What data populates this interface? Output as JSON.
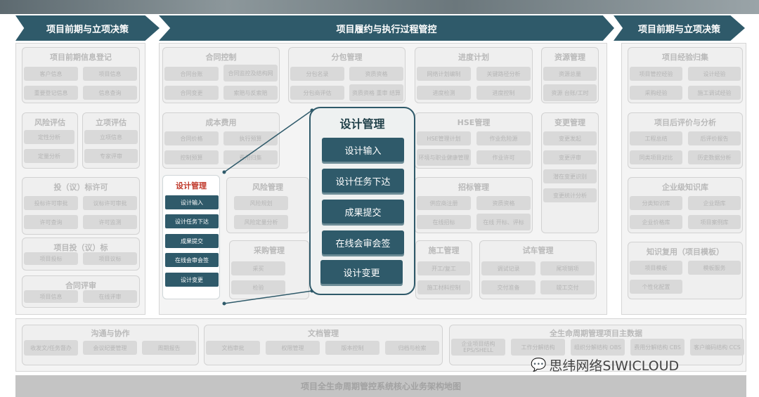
{
  "phases": [
    "项目前期与立项决策",
    "项目履约与执行过程管控",
    "项目前期与立项决策"
  ],
  "left_groups": [
    {
      "title": "项目前期信息登记",
      "cells": [
        "客户信息",
        "项目信息",
        "重要登记信息",
        "信息查询"
      ]
    },
    {
      "title": "风险评估",
      "cells": [
        "定性分析",
        "定量分析"
      ]
    },
    {
      "title": "立项评估",
      "cells": [
        "立项信息",
        "专家评审"
      ]
    },
    {
      "title": "投（议）标许可",
      "cells": [
        "投标许可审批",
        "议标许可审批",
        "许可查询",
        "许可监测"
      ]
    },
    {
      "title": "项目投（议）标",
      "cells": [
        "项目投标",
        "项目议标"
      ]
    },
    {
      "title": "合同评审",
      "cells": [
        "项目信息",
        "在线评审"
      ]
    }
  ],
  "mid_groups": [
    {
      "title": "合同控制",
      "cells": [
        "合同台账",
        "合同监控及结构网",
        "合同变更",
        "索赔与反索赔"
      ]
    },
    {
      "title": "分包管理",
      "cells": [
        "分包名录",
        "资质资格",
        "分包商评估",
        "资质资格 重审 结算"
      ]
    },
    {
      "title": "进度计划",
      "cells": [
        "网络计划编制",
        "关键路径分析",
        "进度检测",
        "进度控制"
      ]
    },
    {
      "title": "资源管理",
      "cells": [
        "资源总量",
        "资源 台账/工时"
      ]
    },
    {
      "title": "成本费用",
      "cells": [
        "合同价格",
        "执行预算",
        "控制预算",
        "费用归集"
      ]
    },
    {
      "title": "HSE管理",
      "cells": [
        "HSE管理计划",
        "作业危险源",
        "环境与职业健康管理",
        "作业许可"
      ]
    },
    {
      "title": "变更管理",
      "cells": [
        "变更发起",
        "变更评审",
        "潜在变更识别",
        "变更统计分析"
      ]
    },
    {
      "title": "风险管理",
      "cells": [
        "风险规划",
        "风险定量分析"
      ]
    },
    {
      "title": "招标管理",
      "cells": [
        "供应商注册",
        "资质资格",
        "在线招标",
        "在线 开标、评标"
      ]
    },
    {
      "title": "采购管理",
      "cells": [
        "采买",
        "检验"
      ]
    },
    {
      "title": "施工管理",
      "cells": [
        "开工/复工",
        "施工材料控制"
      ]
    },
    {
      "title": "试车管理",
      "cells": [
        "调试记录",
        "尾项销项",
        "交付准备",
        "竣工交付"
      ]
    }
  ],
  "right_groups": [
    {
      "title": "项目经验归集",
      "cells": [
        "项目管控经验",
        "设计经验",
        "采购经验",
        "施工调试经验"
      ]
    },
    {
      "title": "项目后评价与分析",
      "cells": [
        "工程总结",
        "后评价报告",
        "同类项目对比",
        "历史数据分析"
      ]
    },
    {
      "title": "企业级知识库",
      "cells": [
        "分类知识库",
        "企业题库",
        "企业价格库",
        "项目案例库"
      ]
    },
    {
      "title": "知识复用（项目模板）",
      "cells": [
        "项目模板",
        "模板服务",
        "个性化配置"
      ]
    }
  ],
  "bottom_groups": [
    {
      "title": "沟通与协作",
      "cells": [
        "收发文/任务督办",
        "会议纪要管理",
        "周期报告"
      ]
    },
    {
      "title": "文档管理",
      "cells": [
        "文档审批",
        "权限管理",
        "版本控制",
        "归档与检索"
      ]
    },
    {
      "title": "全生命周期管理项目主数据",
      "cells": [
        "企业项目结构 EPS/SHELL",
        "工作分解结构",
        "组织分解结构 OBS",
        "费用分解结构 CBS",
        "客户编码结构 CCS"
      ]
    }
  ],
  "highlight": {
    "title": "设计管理",
    "items": [
      "设计输入",
      "设计任务下达",
      "成果提交",
      "在线会审会签",
      "设计变更"
    ]
  },
  "popup": {
    "title": "设计管理",
    "items": [
      "设计输入",
      "设计任务下达",
      "成果提交",
      "在线会审会签",
      "设计变更"
    ]
  },
  "footer": "项目全生命周期管控系统核心业务架构地图",
  "watermark": "思纬网络SIWICLOUD",
  "colors": {
    "accent": "#2f5a6a",
    "highlight_title": "#c0392b"
  }
}
